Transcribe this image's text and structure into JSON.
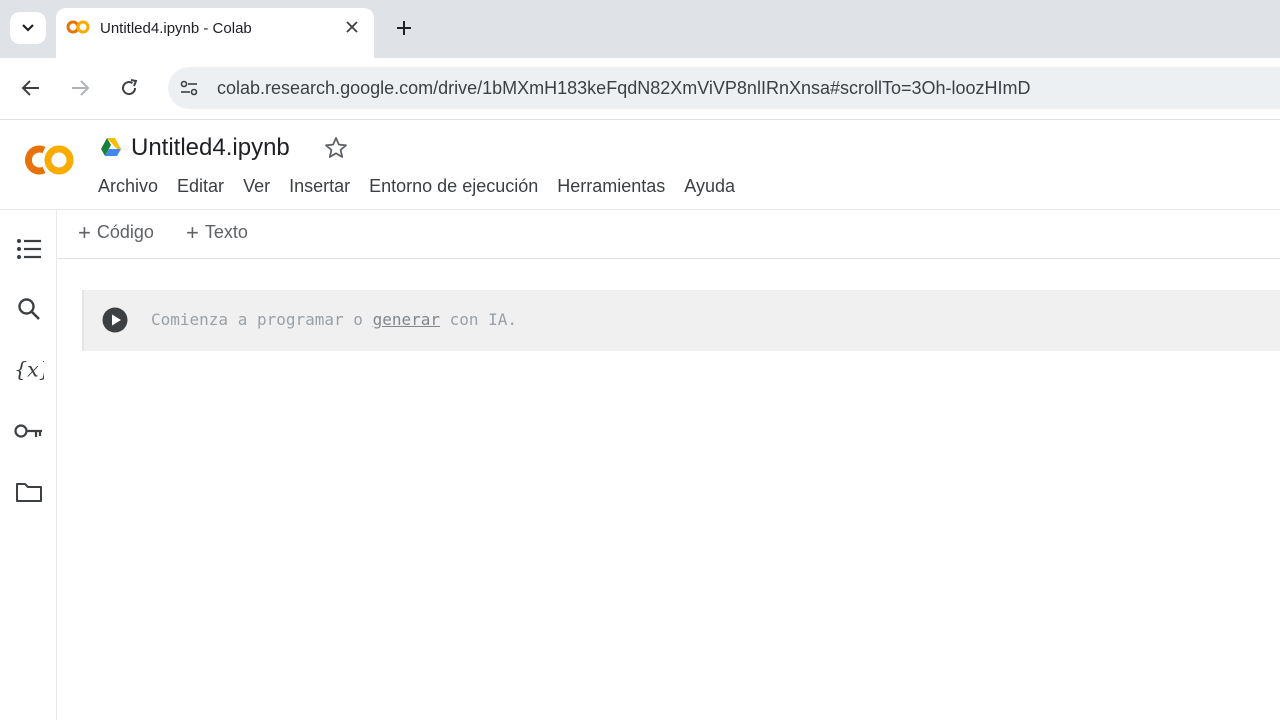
{
  "browser": {
    "tab_title": "Untitled4.ipynb - Colab",
    "url": "colab.research.google.com/drive/1bMXmH183keFqdN82XmViVP8nlIRnXnsa#scrollTo=3Oh-loozHImD"
  },
  "colab": {
    "logo_text": "CO",
    "notebook_title": "Untitled4.ipynb",
    "menu": [
      "Archivo",
      "Editar",
      "Ver",
      "Insertar",
      "Entorno de ejecución",
      "Herramientas",
      "Ayuda"
    ],
    "add_code_label": "Código",
    "add_text_label": "Texto",
    "cell": {
      "prompt_before": "Comienza a programar o ",
      "prompt_link": "generar",
      "prompt_after": " con IA."
    },
    "rail_icons": [
      "table-of-contents-icon",
      "search-icon",
      "variables-icon",
      "secrets-key-icon",
      "folder-icon"
    ]
  },
  "colors": {
    "logo_orange": "#F9AB00",
    "logo_dark_orange": "#E8710A",
    "tabstrip_bg": "#DFE3E8",
    "cell_bg": "#F0F0F0"
  }
}
